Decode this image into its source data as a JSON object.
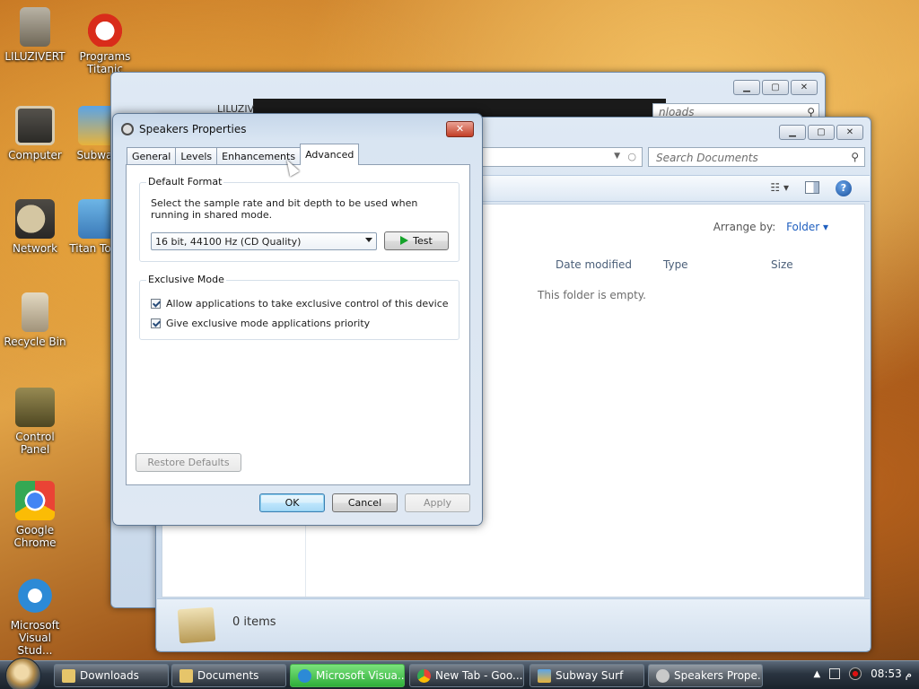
{
  "desktop_icons": [
    {
      "label": "LILUZIVERT",
      "icon": "user-folder-icon"
    },
    {
      "label": "Programs Titanic",
      "icon": "programs-icon"
    },
    {
      "label": "Computer",
      "icon": "computer-icon"
    },
    {
      "label": "Subway",
      "icon": "subway-icon"
    },
    {
      "label": "Network",
      "icon": "network-icon"
    },
    {
      "label": "Titan Tools",
      "icon": "titan-tools-icon"
    },
    {
      "label": "Recycle Bin",
      "icon": "recycle-bin-icon"
    },
    {
      "label": "Control Panel",
      "icon": "control-panel-icon"
    },
    {
      "label": "Google Chrome",
      "icon": "chrome-icon"
    },
    {
      "label": "Microsoft Visual Stud...",
      "icon": "visual-studio-icon"
    }
  ],
  "back_window": {
    "path_fragment": "LILUZIV",
    "search_placeholder": "nloads"
  },
  "explorer": {
    "search_placeholder": "Search Documents",
    "arrange_label": "Arrange by:",
    "arrange_value": "Folder ▾",
    "columns": [
      "Date modified",
      "Type",
      "Size"
    ],
    "empty_text": "This folder is empty.",
    "status": "0 items"
  },
  "dialog": {
    "title": "Speakers Properties",
    "close_glyph": "✕",
    "tabs": [
      "General",
      "Levels",
      "Enhancements",
      "Advanced"
    ],
    "active_tab": "Advanced",
    "default_format": {
      "legend": "Default Format",
      "description": "Select the sample rate and bit depth to be used when running in shared mode.",
      "selected": "16 bit, 44100 Hz (CD Quality)",
      "test_label": "Test"
    },
    "exclusive_mode": {
      "legend": "Exclusive Mode",
      "options": [
        {
          "label": "Allow applications to take exclusive control of this device",
          "checked": true
        },
        {
          "label": "Give exclusive mode applications priority",
          "checked": true
        }
      ]
    },
    "restore_label": "Restore Defaults",
    "ok_label": "OK",
    "cancel_label": "Cancel",
    "apply_label": "Apply"
  },
  "taskbar": {
    "items": [
      {
        "label": "Downloads"
      },
      {
        "label": "Documents"
      },
      {
        "label": "Microsoft Visua..."
      },
      {
        "label": "New Tab - Goo..."
      },
      {
        "label": "Subway Surf"
      },
      {
        "label": "Speakers Prope..."
      }
    ],
    "clock": "08:53 م"
  }
}
